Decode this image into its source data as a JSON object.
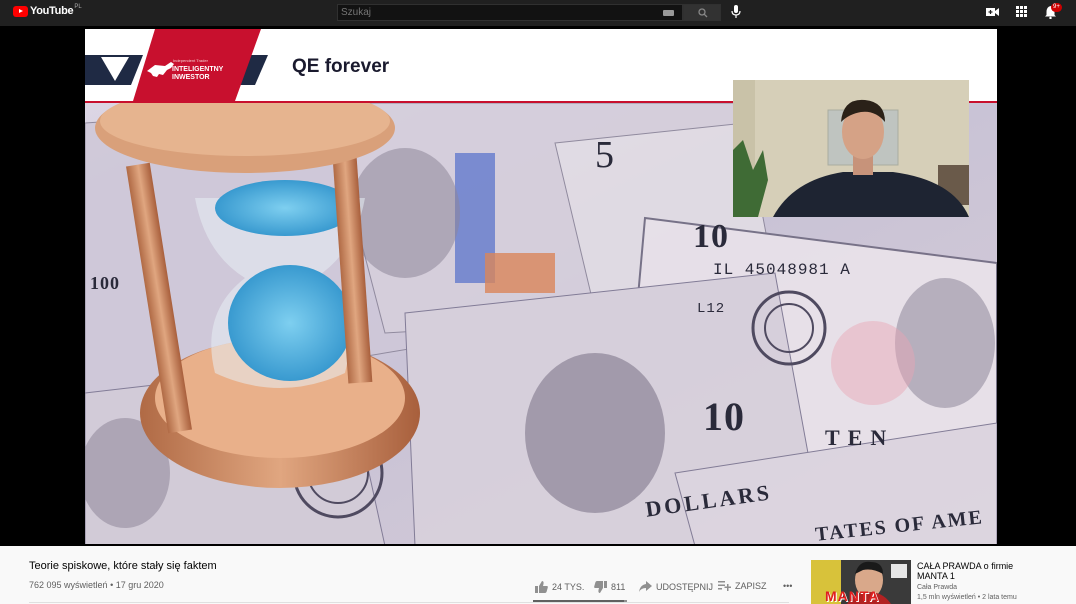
{
  "header": {
    "logo_text": "YouTube",
    "country_code": "PL",
    "search_placeholder": "Szukaj",
    "notification_count": "9+"
  },
  "slide": {
    "brand_small": "Independent Trader",
    "brand_line1": "INTELIGENTNY",
    "brand_line2": "INWESTOR",
    "title": "QE forever",
    "serial_number": "IL 45048981 A",
    "bill_code": "L12",
    "bill_word_ten": "TEN",
    "bill_ten": "10",
    "bill_five": "5",
    "bill_hundred": "100",
    "bill_dollars": "DOLLARS",
    "bill_states": "TATES OF AME"
  },
  "video": {
    "title": "Teorie spiskowe, które stały się faktem",
    "views": "762 095 wyświetleń",
    "date": "17 gru 2020",
    "likes": "24 TYS.",
    "dislikes": "811",
    "like_ratio": 0.967,
    "share_label": "UDOSTĘPNIJ",
    "save_label": "ZAPISZ",
    "more_label": "•••"
  },
  "recommendation": {
    "title": "CAŁA PRAWDA o firmie MANTA 1",
    "channel": "Cała Prawda",
    "views": "1,5 mln wyświetleń",
    "age": "2 lata temu",
    "thumb_text": "MANTA"
  },
  "colors": {
    "topbar": "#202020",
    "brand_red": "#c8102e",
    "brand_navy": "#1f2a44",
    "youtube_red": "#ff0000",
    "page_bg": "#f9f9f9"
  },
  "icons": [
    "youtube-logo-icon",
    "keyboard-icon",
    "search-icon",
    "microphone-icon",
    "create-video-icon",
    "apps-grid-icon",
    "notifications-bell-icon",
    "thumbs-up-icon",
    "thumbs-down-icon",
    "share-icon",
    "add-to-playlist-icon",
    "more-icon"
  ]
}
